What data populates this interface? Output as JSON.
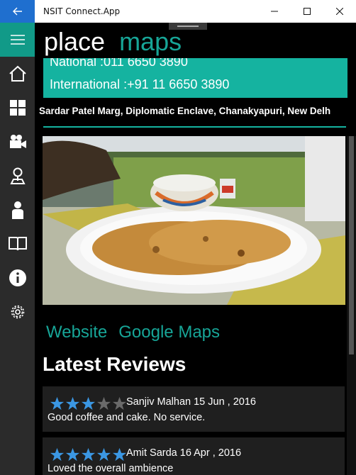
{
  "window": {
    "title": "NSIT Connect.App",
    "back_icon": "arrow-left-icon",
    "controls": [
      "minimize-icon",
      "maximize-icon",
      "close-icon"
    ]
  },
  "sidebar": {
    "accent": "#119a88",
    "items": [
      {
        "icon": "home-icon"
      },
      {
        "icon": "grid-icon"
      },
      {
        "icon": "video-camera-icon"
      },
      {
        "icon": "map-pin-icon"
      },
      {
        "icon": "person-icon"
      },
      {
        "icon": "book-icon"
      },
      {
        "icon": "info-icon"
      },
      {
        "icon": "gear-icon"
      }
    ]
  },
  "header": {
    "title_primary": "place",
    "title_secondary": "maps",
    "accent": "#17a597"
  },
  "place": {
    "national": "National :011 6650 3890",
    "international": "International :+91 11 6650 3890",
    "address": "Sardar Patel Marg, Diplomatic Enclave, Chanakyapuri, New Delh",
    "photo_description": "plate of stuffed parathas with bowl of curd"
  },
  "links": {
    "website": "Website",
    "google_maps": "Google Maps"
  },
  "reviews": {
    "title": "Latest Reviews",
    "items": [
      {
        "rating": 3,
        "max": 5,
        "author": "Sanjiv Malhan",
        "date": "15 Jun , 2016",
        "text": "Good coffee and cake. No service."
      },
      {
        "rating": 5,
        "max": 5,
        "author": "Amit Sarda",
        "date": "16 Apr , 2016",
        "text": "Loved the overall ambience"
      }
    ]
  }
}
